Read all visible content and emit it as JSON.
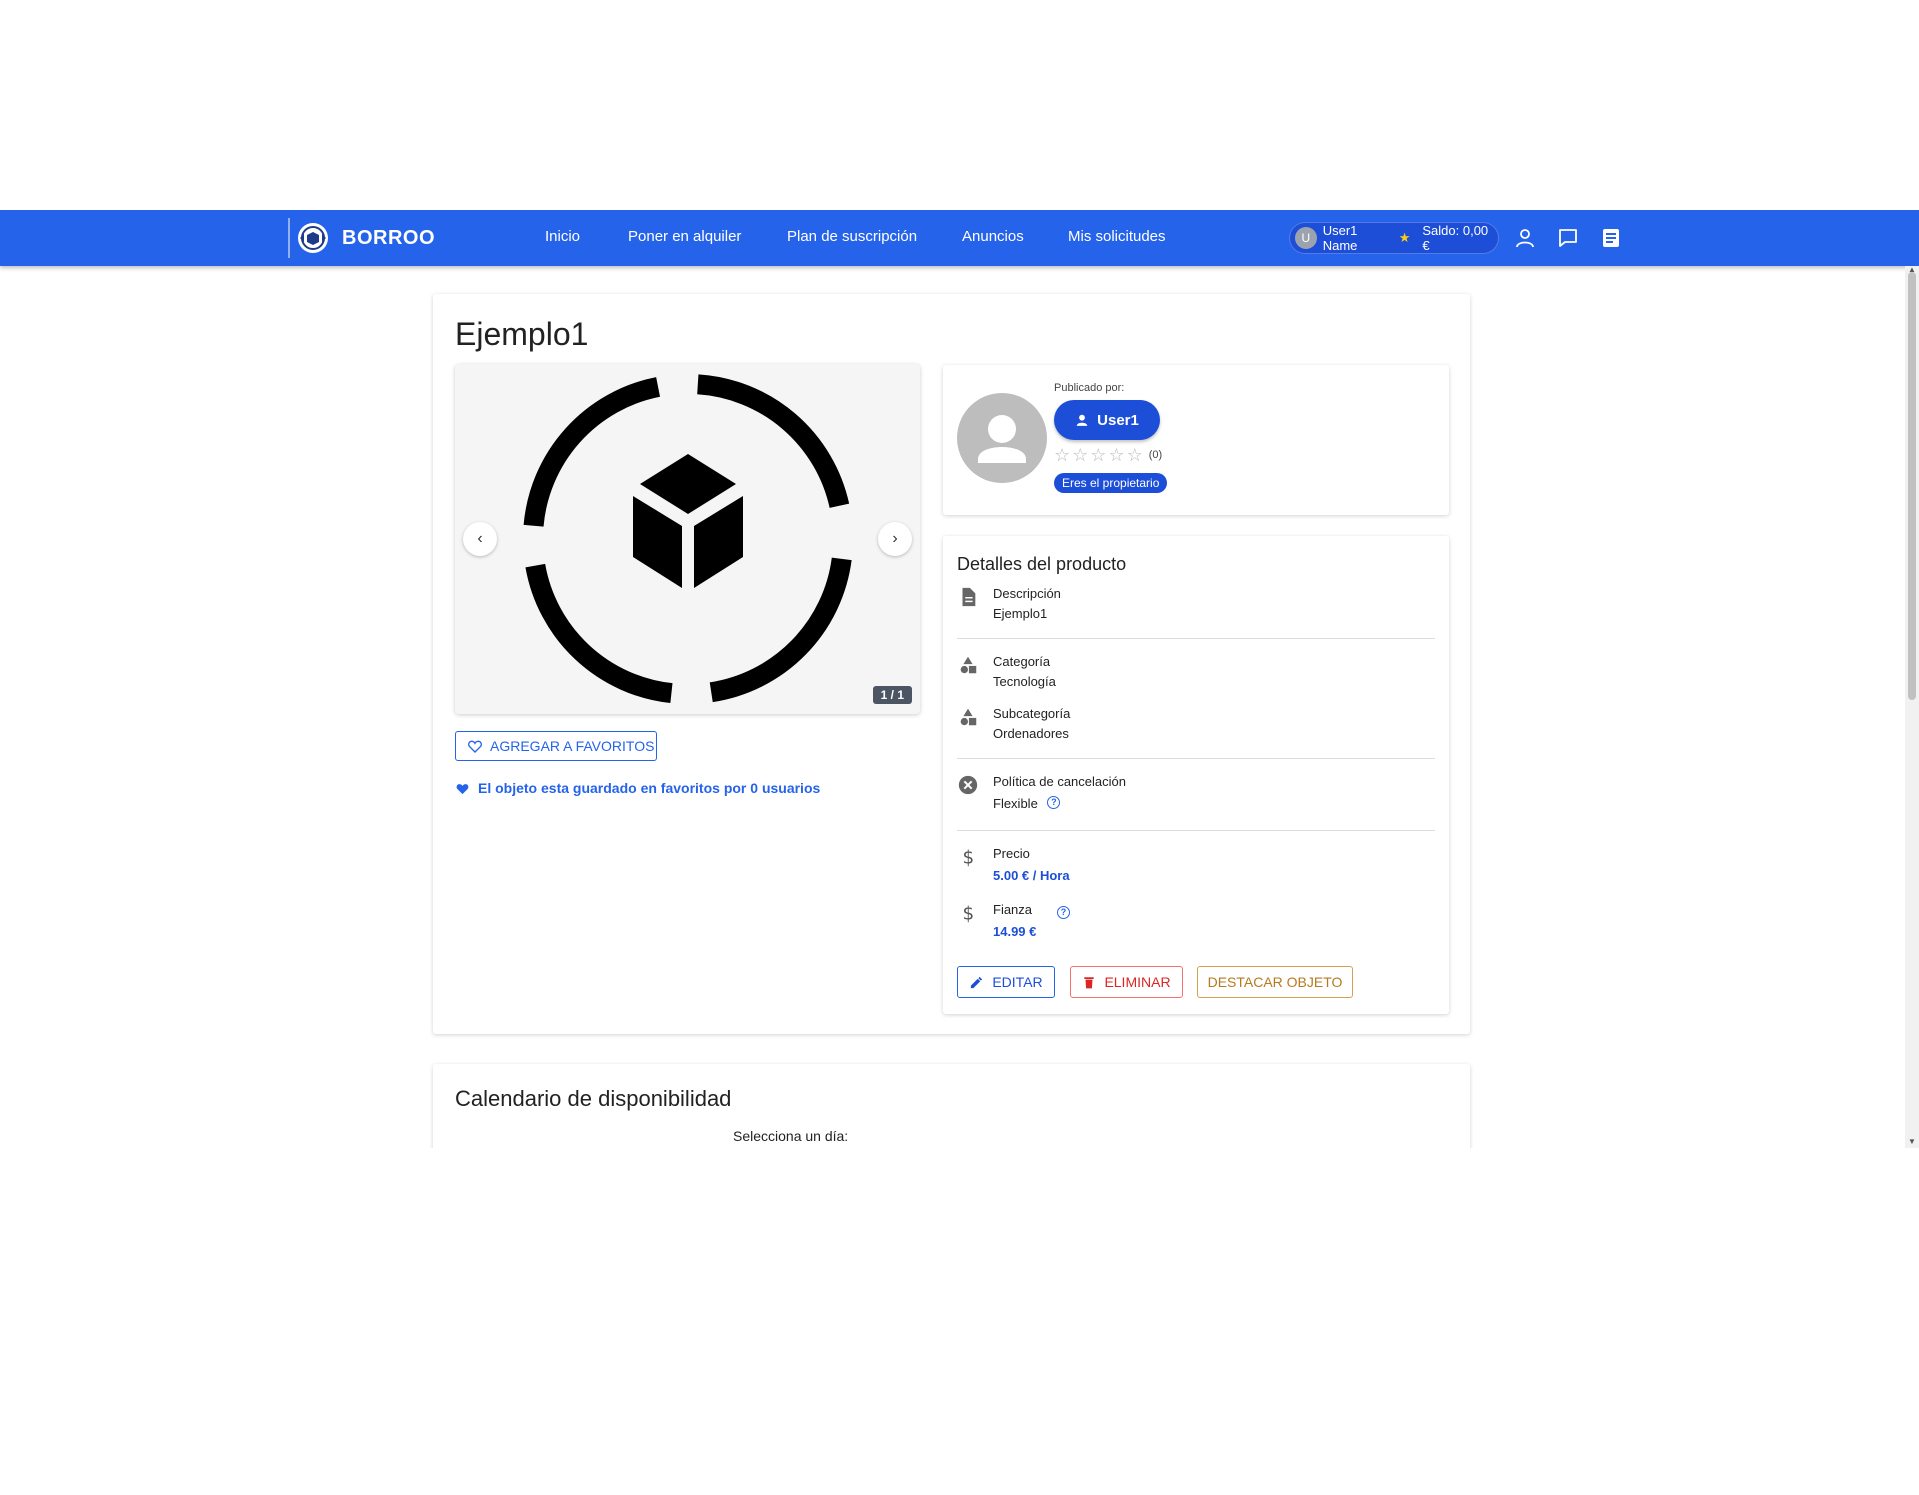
{
  "navbar": {
    "brand": "BORROO",
    "links": [
      "Inicio",
      "Poner en alquiler",
      "Plan de suscripción",
      "Anuncios",
      "Mis solicitudes"
    ],
    "user_initial": "U",
    "user_name": "User1 Name",
    "balance": "Saldo: 0,00 €",
    "colors": {
      "bar": "#2563eb"
    }
  },
  "product": {
    "title": "Ejemplo1",
    "image_counter": "1 / 1",
    "favorite_button": "AGREGAR A FAVORITOS",
    "favorite_note": "El objeto esta guardado en favoritos por 0 usuarios"
  },
  "owner": {
    "published_by_label": "Publicado por:",
    "username": "User1",
    "rating_count": "(0)",
    "rating": 0,
    "badge": "Eres el propietario"
  },
  "details": {
    "title": "Detalles del producto",
    "description_label": "Descripción",
    "description_value": "Ejemplo1",
    "category_label": "Categoría",
    "category_value": "Tecnología",
    "subcategory_label": "Subcategoría",
    "subcategory_value": "Ordenadores",
    "cancellation_label": "Política de cancelación",
    "cancellation_value": "Flexible",
    "price_label": "Precio",
    "price_value": "5.00 € / Hora",
    "deposit_label": "Fianza",
    "deposit_value": "14.99 €"
  },
  "actions": {
    "edit": "EDITAR",
    "delete": "ELIMINAR",
    "feature": "DESTACAR OBJETO"
  },
  "calendar": {
    "title": "Calendario de disponibilidad",
    "select_day": "Selecciona un día:"
  }
}
